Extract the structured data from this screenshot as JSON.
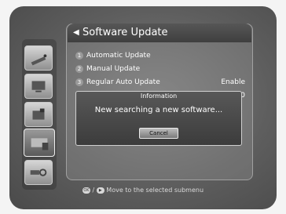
{
  "title": "Software Update",
  "menu": [
    {
      "num": "1",
      "label": "Automatic Update",
      "value": ""
    },
    {
      "num": "2",
      "label": "Manual Update",
      "value": ""
    },
    {
      "num": "3",
      "label": "Regular Auto Update",
      "value": "Enable"
    },
    {
      "num": "",
      "label": "",
      "value": "04:00"
    }
  ],
  "dialog": {
    "title": "Information",
    "message": "New searching a new software...",
    "button": "Cancel"
  },
  "hint": {
    "ok_key": "OK",
    "text": "Move to the selected submenu"
  },
  "rail_icons": [
    "satellite-icon",
    "tv-icon",
    "setup-icon",
    "update-icon",
    "usb-search-icon"
  ],
  "colors": {
    "accent": "#4a4a4a",
    "dialog": "#4b4b4b"
  }
}
